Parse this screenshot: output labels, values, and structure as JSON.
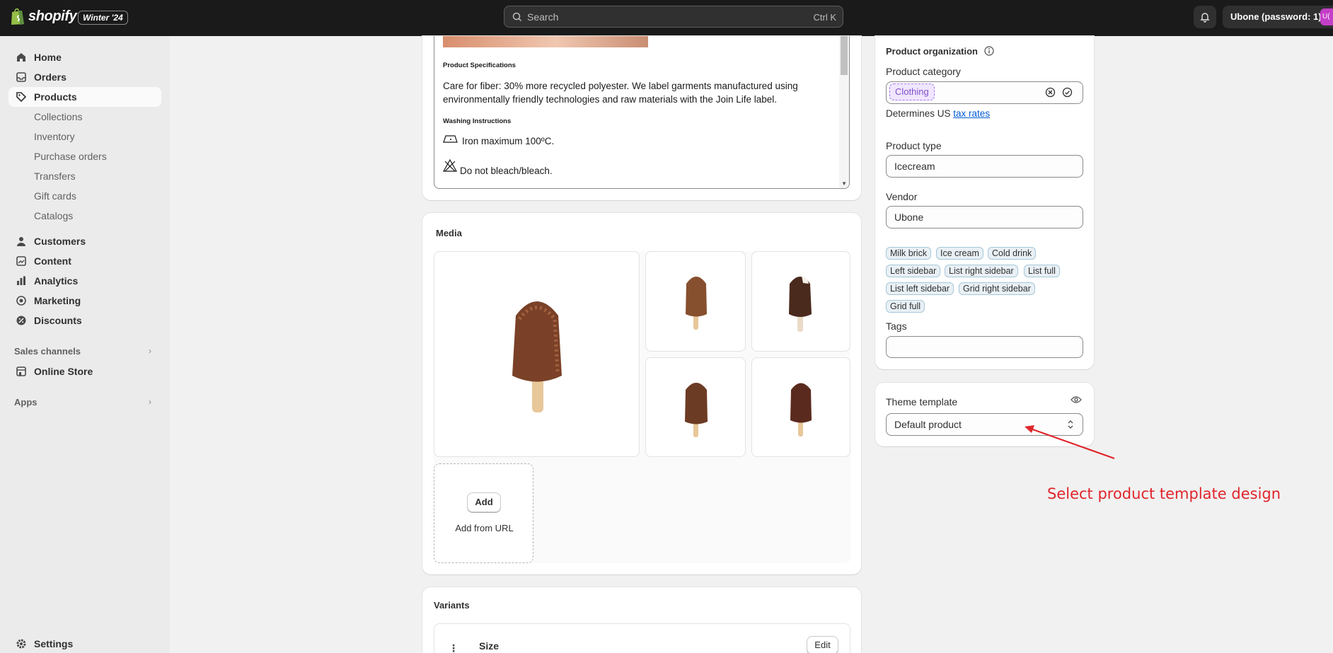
{
  "topbar": {
    "brand": "shopify",
    "badge": "Winter '24",
    "search_placeholder": "Search",
    "search_shortcut": "Ctrl K",
    "store_name": "Ubone (password: 1)",
    "avatar_initials": "U("
  },
  "sidebar": {
    "items": [
      {
        "label": "Home",
        "icon": "home-icon"
      },
      {
        "label": "Orders",
        "icon": "orders-icon"
      },
      {
        "label": "Products",
        "icon": "tag-icon",
        "active": true
      }
    ],
    "product_subitems": [
      "Collections",
      "Inventory",
      "Purchase orders",
      "Transfers",
      "Gift cards",
      "Catalogs"
    ],
    "items2": [
      {
        "label": "Customers",
        "icon": "person-icon"
      },
      {
        "label": "Content",
        "icon": "content-icon"
      },
      {
        "label": "Analytics",
        "icon": "chart-icon"
      },
      {
        "label": "Marketing",
        "icon": "target-icon"
      },
      {
        "label": "Discounts",
        "icon": "discount-icon"
      }
    ],
    "sales_channels_label": "Sales channels",
    "online_store": "Online Store",
    "apps_label": "Apps",
    "settings": "Settings"
  },
  "description": {
    "spec_title": "Product Specifications",
    "care_text": "Care for fiber: 30% more recycled polyester. We label garments manufactured using environmentally friendly technologies and raw materials with the Join Life label.",
    "washing_title": "Washing Instructions",
    "iron_text": "Iron maximum 100ºC.",
    "bleach_text": "Do not bleach/bleach."
  },
  "media": {
    "title": "Media",
    "add_button": "Add",
    "add_from_url": "Add from URL"
  },
  "variants": {
    "title": "Variants",
    "option_name": "Size",
    "edit_button": "Edit"
  },
  "organization": {
    "title": "Product organization",
    "category_label": "Product category",
    "category_value": "Clothing",
    "tax_prefix": "Determines US",
    "tax_link": "tax rates",
    "type_label": "Product type",
    "type_value": "Icecream",
    "vendor_label": "Vendor",
    "vendor_value": "Ubone",
    "collections": [
      "Milk brick",
      "Ice cream",
      "Cold drink",
      "Left sidebar",
      "List right sidebar",
      "List full",
      "List left sidebar",
      "Grid right sidebar",
      "Grid full"
    ],
    "tags_label": "Tags",
    "tags_value": ""
  },
  "theme": {
    "label": "Theme template",
    "value": "Default product"
  },
  "annotation": {
    "text": "Select product template design",
    "color": "#e0252b"
  }
}
